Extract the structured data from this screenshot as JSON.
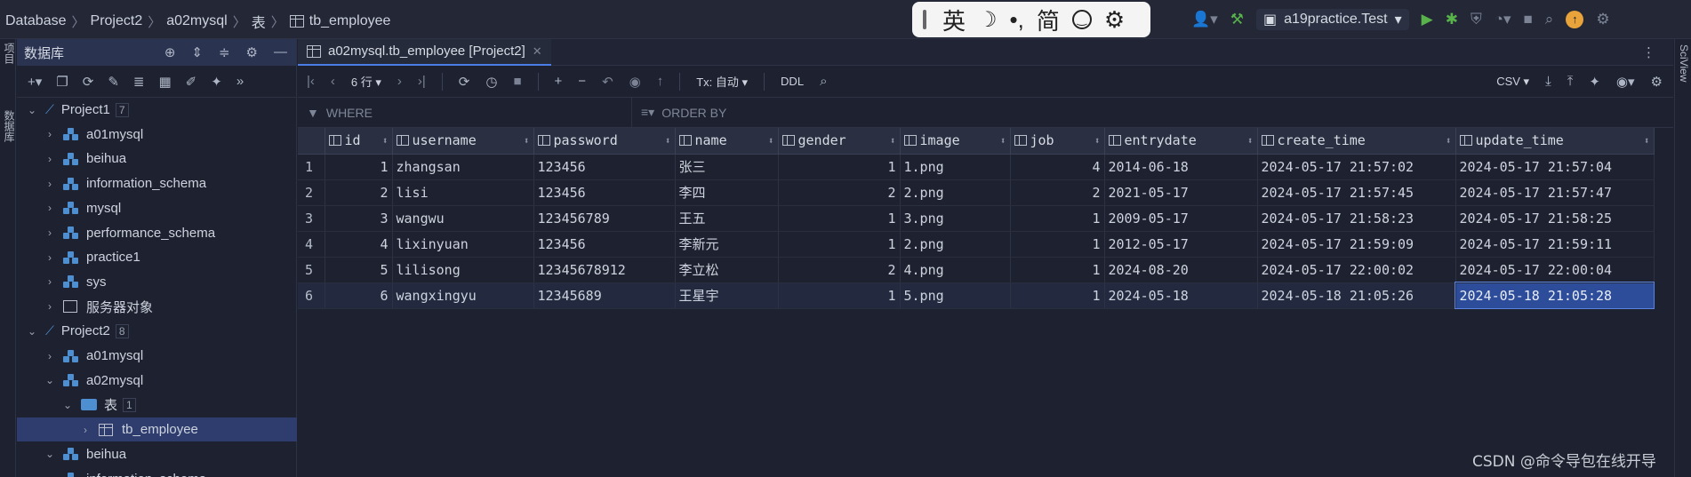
{
  "breadcrumb": [
    "Database",
    "Project2",
    "a02mysql",
    "表",
    "tb_employee"
  ],
  "ime": {
    "lang": "英",
    "punct": "•,",
    "script": "简"
  },
  "run_config": "a19practice.Test",
  "left_strip": {
    "item1": "项目",
    "item2": "数据库"
  },
  "db_panel": {
    "title": "数据库",
    "tree": [
      {
        "label": "Project1",
        "count": "7",
        "level": 0,
        "expanded": true,
        "kind": "project"
      },
      {
        "label": "a01mysql",
        "level": 1,
        "kind": "db"
      },
      {
        "label": "beihua",
        "level": 1,
        "kind": "db"
      },
      {
        "label": "information_schema",
        "level": 1,
        "kind": "db"
      },
      {
        "label": "mysql",
        "level": 1,
        "kind": "db"
      },
      {
        "label": "performance_schema",
        "level": 1,
        "kind": "db"
      },
      {
        "label": "practice1",
        "level": 1,
        "kind": "db"
      },
      {
        "label": "sys",
        "level": 1,
        "kind": "db"
      },
      {
        "label": "服务器对象",
        "level": 1,
        "kind": "server"
      },
      {
        "label": "Project2",
        "count": "8",
        "level": 0,
        "expanded": true,
        "kind": "project"
      },
      {
        "label": "a01mysql",
        "level": 1,
        "kind": "db"
      },
      {
        "label": "a02mysql",
        "level": 1,
        "expanded": true,
        "kind": "db"
      },
      {
        "label": "表",
        "count": "1",
        "level": 2,
        "expanded": true,
        "kind": "folder"
      },
      {
        "label": "tb_employee",
        "level": 3,
        "kind": "table",
        "selected": true
      },
      {
        "label": "beihua",
        "level": 1,
        "expanded": true,
        "kind": "db"
      },
      {
        "label": "information_schema",
        "level": 1,
        "kind": "db"
      }
    ]
  },
  "editor": {
    "tab_label": "a02mysql.tb_employee [Project2]",
    "rows_label": "6 行",
    "tx_label": "Tx: 自动",
    "ddl_label": "DDL",
    "export_label": "CSV",
    "where_placeholder": "WHERE",
    "orderby_placeholder": "ORDER BY"
  },
  "grid": {
    "columns": [
      "id",
      "username",
      "password",
      "name",
      "gender",
      "image",
      "job",
      "entrydate",
      "create_time",
      "update_time"
    ],
    "rows": [
      [
        "1",
        "1",
        "zhangsan",
        "123456",
        "张三",
        "1",
        "1.png",
        "4",
        "2014-06-18",
        "2024-05-17 21:57:02",
        "2024-05-17 21:57:04"
      ],
      [
        "2",
        "2",
        "lisi",
        "123456",
        "李四",
        "2",
        "2.png",
        "2",
        "2021-05-17",
        "2024-05-17 21:57:45",
        "2024-05-17 21:57:47"
      ],
      [
        "3",
        "3",
        "wangwu",
        "123456789",
        "王五",
        "1",
        "3.png",
        "1",
        "2009-05-17",
        "2024-05-17 21:58:23",
        "2024-05-17 21:58:25"
      ],
      [
        "4",
        "4",
        "lixinyuan",
        "123456",
        "李新元",
        "1",
        "2.png",
        "1",
        "2012-05-17",
        "2024-05-17 21:59:09",
        "2024-05-17 21:59:11"
      ],
      [
        "5",
        "5",
        "lilisong",
        "12345678912",
        "李立松",
        "2",
        "4.png",
        "1",
        "2024-08-20",
        "2024-05-17 22:00:02",
        "2024-05-17 22:00:04"
      ],
      [
        "6",
        "6",
        "wangxingyu",
        "12345689",
        "王星宇",
        "1",
        "5.png",
        "1",
        "2024-05-18",
        "2024-05-18 21:05:26",
        "2024-05-18 21:05:28"
      ]
    ],
    "selected_row": 5,
    "selected_col": 10
  },
  "right_strip": {
    "label": "SciView"
  },
  "watermark": "CSDN @命令导包在线开导"
}
